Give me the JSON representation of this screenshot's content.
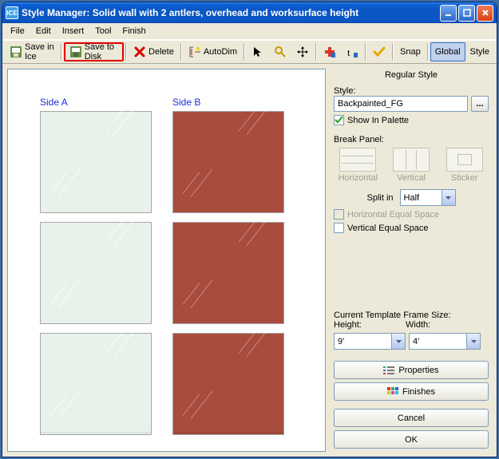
{
  "window": {
    "title": "Style Manager: Solid wall with 2 antlers, overhead and worksurface height",
    "app_icon_text": "ICE"
  },
  "menu": {
    "items": [
      "File",
      "Edit",
      "Insert",
      "Tool",
      "Finish"
    ]
  },
  "toolbar": {
    "save_in_ice": "Save in Ice",
    "save_to_disk": "Save to Disk",
    "delete": "Delete",
    "autodim": "AutoDim",
    "snap": "Snap",
    "global": "Global",
    "style": "Style"
  },
  "canvas": {
    "side_a_label": "Side A",
    "side_b_label": "Side B"
  },
  "props": {
    "title": "Regular Style",
    "style_label": "Style:",
    "style_value": "Backpainted_FG",
    "show_in_palette": "Show In Palette",
    "break_panel_label": "Break Panel:",
    "break_horizontal": "Horizontal",
    "break_vertical": "Vertical",
    "break_sticker": "Sticker",
    "split_in_label": "Split in",
    "split_in_value": "Half",
    "h_equal": "Horizontal Equal Space",
    "v_equal": "Vertical Equal Space",
    "ctfs_label": "Current Template Frame Size:",
    "height_label": "Height:",
    "width_label": "Width:",
    "height_value": "9'",
    "width_value": "4'",
    "properties_btn": "Properties",
    "finishes_btn": "Finishes",
    "cancel_btn": "Cancel",
    "ok_btn": "OK"
  }
}
